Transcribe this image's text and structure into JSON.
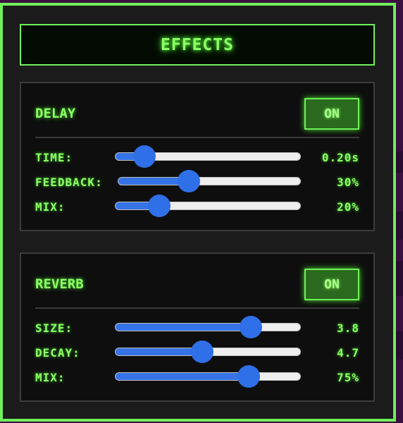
{
  "title": "EFFECTS",
  "colors": {
    "accent": "#6ff05a",
    "text": "#8cff66",
    "slider": "#2f6fe8",
    "panel_bg": "#1b1b1b"
  },
  "delay": {
    "title": "DELAY",
    "toggle_label": "ON",
    "rows": [
      {
        "label": "TIME:",
        "value_text": "0.20s",
        "level": 0.16
      },
      {
        "label": "FEEDBACK:",
        "value_text": "30%",
        "level": 0.39
      },
      {
        "label": "MIX:",
        "value_text": "20%",
        "level": 0.24
      }
    ]
  },
  "reverb": {
    "title": "REVERB",
    "toggle_label": "ON",
    "rows": [
      {
        "label": "SIZE:",
        "value_text": "3.8",
        "level": 0.73
      },
      {
        "label": "DECAY:",
        "value_text": "4.7",
        "level": 0.47
      },
      {
        "label": "MIX:",
        "value_text": "75%",
        "level": 0.72
      }
    ]
  }
}
